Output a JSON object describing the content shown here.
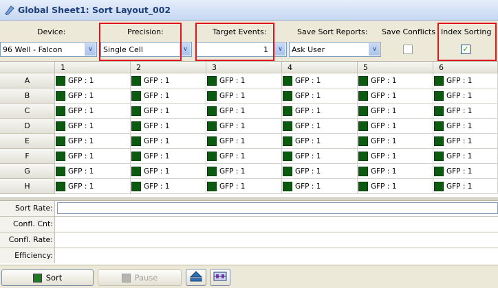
{
  "window": {
    "title": "Global Sheet1: Sort Layout_002",
    "icon": "sheet-icon"
  },
  "toolbar": {
    "device_label": "Device:",
    "device_value": "96 Well - Falcon",
    "precision_label": "Precision:",
    "precision_value": "Single Cell",
    "target_events_label": "Target Events:",
    "target_events_value": "1",
    "save_sort_reports_label": "Save Sort Reports:",
    "save_sort_reports_value": "Ask User",
    "save_conflicts_label": "Save Conflicts",
    "save_conflicts_checked": false,
    "index_sorting_label": "Index Sorting",
    "index_sorting_checked": true,
    "check_glyph": "✓",
    "dropdown_glyph": "∨"
  },
  "grid": {
    "columns": [
      "1",
      "2",
      "3",
      "4",
      "5",
      "6"
    ],
    "rows": [
      "A",
      "B",
      "C",
      "D",
      "E",
      "F",
      "G",
      "H"
    ],
    "cell_text": "GFP : 1",
    "swatch_color": "#0b5a10"
  },
  "stats": {
    "sort_rate_label": "Sort Rate:",
    "confl_cnt_label": "Confl. Cnt:",
    "confl_rate_label": "Confl. Rate:",
    "efficiency_label": "Efficiency:"
  },
  "buttons": {
    "sort_label": "Sort",
    "pause_label": "Pause",
    "sort_swatch_color": "#1f7a24",
    "pause_swatch_color": "#b4b4b0",
    "eject_icon": "eject-icon",
    "stage-icon": "sort-stage-icon"
  },
  "colors": {
    "highlight_box": "#e0141c",
    "title_text": "#1c3f7a"
  }
}
